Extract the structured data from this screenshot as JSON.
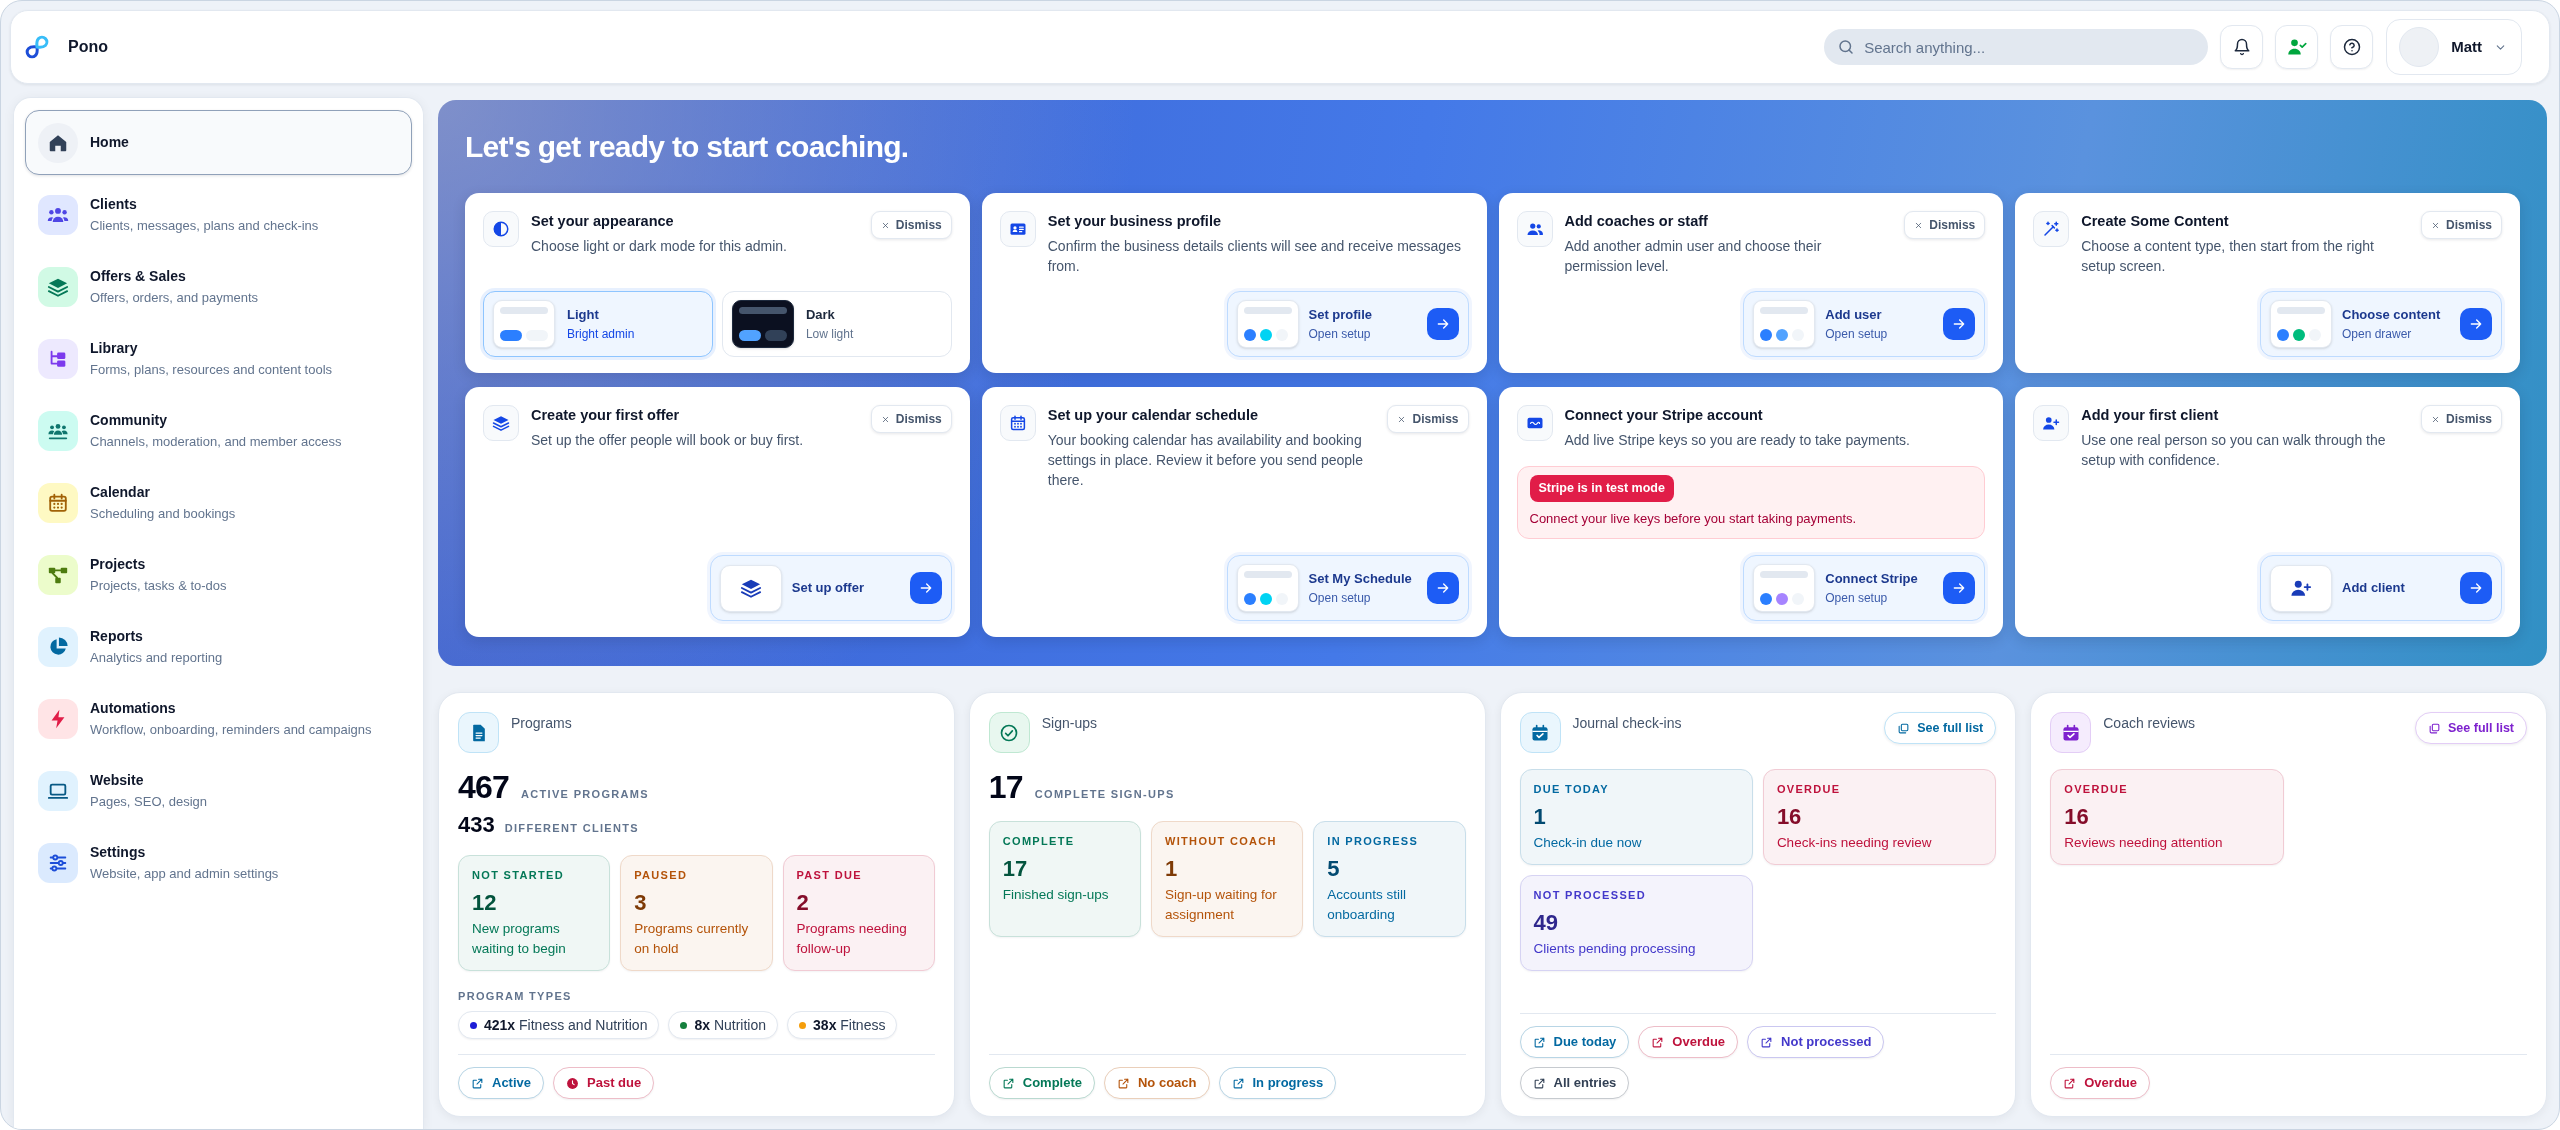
{
  "app": {
    "name": "Pono"
  },
  "topbar": {
    "search": {
      "placeholder": "Search anything..."
    },
    "user": {
      "name": "Matt"
    }
  },
  "sidebar": {
    "items": [
      {
        "title": "Home",
        "selected": true
      },
      {
        "title": "Clients",
        "subtitle": "Clients, messages, plans and check-ins",
        "selected": false
      },
      {
        "title": "Offers & Sales",
        "subtitle": "Offers, orders, and payments",
        "selected": false
      },
      {
        "title": "Library",
        "subtitle": "Forms, plans, resources and content tools",
        "selected": false
      },
      {
        "title": "Community",
        "subtitle": "Channels, moderation, and member access",
        "selected": false
      },
      {
        "title": "Calendar",
        "subtitle": "Scheduling and bookings",
        "selected": false
      },
      {
        "title": "Projects",
        "subtitle": "Projects, tasks & to-dos",
        "selected": false
      },
      {
        "title": "Reports",
        "subtitle": "Analytics and reporting",
        "selected": false
      },
      {
        "title": "Automations",
        "subtitle": "Workflow, onboarding, reminders and campaigns",
        "selected": false
      },
      {
        "title": "Website",
        "subtitle": "Pages, SEO, design",
        "selected": false
      },
      {
        "title": "Settings",
        "subtitle": "Website, app and admin settings",
        "selected": false
      }
    ]
  },
  "hero": {
    "title": "Let's get ready to start coaching.",
    "cards": [
      {
        "title": "Set your appearance",
        "description": "Choose light or dark mode for this admin.",
        "dismiss": "Dismiss",
        "theme_options": [
          {
            "kind": "light",
            "label": "Light",
            "caption": "Bright admin",
            "selected": true
          },
          {
            "kind": "dark",
            "label": "Dark",
            "caption": "Low light",
            "selected": false
          }
        ]
      },
      {
        "title": "Set your business profile",
        "description": "Confirm the business details clients will see and receive messages from.",
        "action": {
          "kind": "preview",
          "label": "Set profile",
          "caption": "Open setup"
        }
      },
      {
        "title": "Add coaches or staff",
        "description": "Add another admin user and choose their permission level.",
        "dismiss": "Dismiss",
        "action": {
          "kind": "preview",
          "label": "Add user",
          "caption": "Open setup"
        }
      },
      {
        "title": "Create Some Content",
        "description": "Choose a content type, then start from the right setup screen.",
        "dismiss": "Dismiss",
        "action": {
          "kind": "preview",
          "label": "Choose content",
          "caption": "Open drawer"
        }
      },
      {
        "title": "Create your first offer",
        "description": "Set up the offer people will book or buy first.",
        "dismiss": "Dismiss",
        "action": {
          "kind": "icon",
          "label": "Set up offer"
        }
      },
      {
        "title": "Set up your calendar schedule",
        "description": "Your booking calendar has availability and booking settings in place. Review it before you send people there.",
        "dismiss": "Dismiss",
        "action": {
          "kind": "preview",
          "label": "Set My Schedule",
          "caption": "Open setup"
        }
      },
      {
        "title": "Connect your Stripe account",
        "description": "Add live Stripe keys so you are ready to take payments.",
        "alert": {
          "badge": "Stripe is in test mode",
          "text": "Connect your live keys before you start taking payments."
        },
        "action": {
          "kind": "preview",
          "label": "Connect Stripe",
          "caption": "Open setup"
        }
      },
      {
        "title": "Add your first client",
        "description": "Use one real person so you can walk through the setup with confidence.",
        "dismiss": "Dismiss",
        "action": {
          "kind": "icon",
          "label": "Add client"
        }
      }
    ]
  },
  "summary_cards": [
    {
      "title": "Programs",
      "headline": {
        "value": "467",
        "label": "ACTIVE PROGRAMS"
      },
      "subline": {
        "value": "433",
        "label": "DIFFERENT CLIENTS"
      },
      "tiles": [
        {
          "label": "NOT STARTED",
          "value": "12",
          "description": "New programs waiting to begin",
          "color": "#047857"
        },
        {
          "label": "PAUSED",
          "value": "3",
          "description": "Programs currently on hold",
          "color": "#b45309"
        },
        {
          "label": "PAST DUE",
          "value": "2",
          "description": "Programs needing follow-up",
          "color": "#be123c"
        }
      ],
      "program_types": {
        "label": "PROGRAM TYPES",
        "items": [
          {
            "count": "421x",
            "name": "Fitness and Nutrition",
            "color": "#1d1dd6"
          },
          {
            "count": "8x",
            "name": "Nutrition",
            "color": "#15803d"
          },
          {
            "count": "38x",
            "name": "Fitness",
            "color": "#f59e0b"
          }
        ]
      },
      "links": [
        {
          "kind": "external",
          "label": "Active",
          "color": "#0369a1"
        },
        {
          "kind": "clock",
          "label": "Past due",
          "color": "#be123c"
        }
      ]
    },
    {
      "title": "Sign-ups",
      "headline": {
        "value": "17",
        "label": "COMPLETE SIGN-UPS"
      },
      "tiles": [
        {
          "label": "COMPLETE",
          "value": "17",
          "description": "Finished sign-ups",
          "color": "#047857"
        },
        {
          "label": "WITHOUT COACH",
          "value": "1",
          "description": "Sign-up waiting for assignment",
          "color": "#b45309"
        },
        {
          "label": "IN PROGRESS",
          "value": "5",
          "description": "Accounts still onboarding",
          "color": "#0369a1"
        }
      ],
      "links": [
        {
          "kind": "external",
          "label": "Complete",
          "color": "#047857"
        },
        {
          "kind": "external",
          "label": "No coach",
          "color": "#b45309"
        },
        {
          "kind": "external",
          "label": "In progress",
          "color": "#0369a1"
        }
      ]
    },
    {
      "title": "Journal check-ins",
      "see_full_list": "See full list",
      "tiles": [
        {
          "label": "DUE TODAY",
          "value": "1",
          "description": "Check-in due now",
          "color": "#0369a1"
        },
        {
          "label": "OVERDUE",
          "value": "16",
          "description": "Check-ins needing review",
          "color": "#be123c"
        },
        {
          "label": "NOT PROCESSED",
          "value": "49",
          "description": "Clients pending processing",
          "color": "#4338ca"
        }
      ],
      "links": [
        {
          "kind": "external",
          "label": "Due today",
          "color": "#0369a1"
        },
        {
          "kind": "external",
          "label": "Overdue",
          "color": "#be123c"
        },
        {
          "kind": "external",
          "label": "Not processed",
          "color": "#4338ca"
        },
        {
          "kind": "external",
          "label": "All entries",
          "color": "#334155"
        }
      ]
    },
    {
      "title": "Coach reviews",
      "see_full_list": "See full list",
      "tiles": [
        {
          "label": "OVERDUE",
          "value": "16",
          "description": "Reviews needing attention",
          "color": "#be123c"
        }
      ],
      "links": [
        {
          "kind": "external",
          "label": "Overdue",
          "color": "#be123c"
        }
      ]
    }
  ]
}
